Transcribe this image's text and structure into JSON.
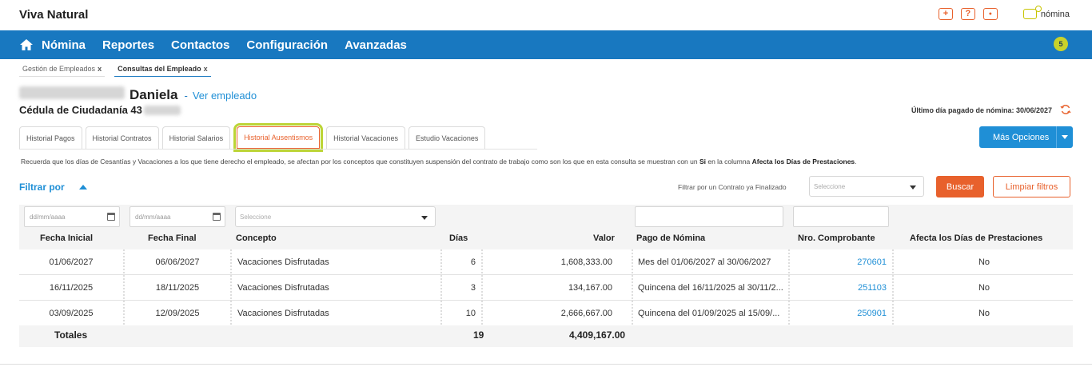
{
  "app": {
    "title": "Viva Natural"
  },
  "top_icons": [
    {
      "name": "plus-icon",
      "glyph": "+"
    },
    {
      "name": "help-icon",
      "glyph": "?"
    },
    {
      "name": "user-icon",
      "glyph": "●"
    }
  ],
  "chat": {
    "label": "nómina",
    "icon": "chat-icon"
  },
  "nav": {
    "items": [
      "Nómina",
      "Reportes",
      "Contactos",
      "Configuración",
      "Avanzadas"
    ],
    "badge": "5"
  },
  "breadcrumbs": [
    {
      "label": "Gestión de Empleados",
      "close": "x"
    },
    {
      "label": "Consultas del Empleado",
      "close": "x"
    }
  ],
  "employee": {
    "first_name": "Daniela",
    "separator": "-",
    "view_link": "Ver empleado",
    "id_label": "Cédula de Ciudadanía 43"
  },
  "last_paid": "Último día pagado de nómina: 30/06/2027",
  "tabs": [
    "Historial Pagos",
    "Historial Contratos",
    "Historial Salarios",
    "Historial Ausentismos",
    "Historial Vacaciones",
    "Estudio Vacaciones"
  ],
  "active_tab": "Historial Ausentismos",
  "more_options": "Más Opciones",
  "notice": {
    "pre": "Recuerda que los días de Cesantías y Vacaciones a los que tiene derecho el empleado, se afectan por los conceptos que constituyen suspensión del contrato de trabajo como son los que en esta consulta se muestran con un ",
    "si": "Si",
    "mid": " en la columna ",
    "col": "Afecta los Días de Prestaciones",
    "end": "."
  },
  "filters": {
    "title": "Filtrar por",
    "contrato_label": "Filtrar por un Contrato ya Finalizado",
    "contrato_placeholder": "Seleccione",
    "date_placeholder": "dd/mm/aaaa",
    "concepto_placeholder": "Seleccione",
    "buscar": "Buscar",
    "limpiar": "Limpiar filtros"
  },
  "table": {
    "headers": [
      "Fecha Inicial",
      "Fecha Final",
      "Concepto",
      "Días",
      "Valor",
      "Pago de Nómina",
      "Nro. Comprobante",
      "Afecta los Días de Prestaciones"
    ],
    "rows": [
      {
        "inicio": "01/06/2027",
        "fin": "06/06/2027",
        "concepto": "Vacaciones Disfrutadas",
        "dias": "6",
        "valor": "1,608,333.00",
        "pago": "Mes del 01/06/2027 al 30/06/2027",
        "comprobante": "270601",
        "afecta": "No"
      },
      {
        "inicio": "16/11/2025",
        "fin": "18/11/2025",
        "concepto": "Vacaciones Disfrutadas",
        "dias": "3",
        "valor": "134,167.00",
        "pago": "Quincena del 16/11/2025 al 30/11/2...",
        "comprobante": "251103",
        "afecta": "No"
      },
      {
        "inicio": "03/09/2025",
        "fin": "12/09/2025",
        "concepto": "Vacaciones Disfrutadas",
        "dias": "10",
        "valor": "2,666,667.00",
        "pago": "Quincena del 01/09/2025 al 15/09/...",
        "comprobante": "250901",
        "afecta": "No"
      }
    ],
    "totals": {
      "label": "Totales",
      "dias": "19",
      "valor": "4,409,167.00"
    }
  },
  "colors": {
    "primary": "#1878c0",
    "accent": "#e8612c",
    "highlight": "#bcd436",
    "badge": "#c9d22b",
    "link": "#1f8fd6"
  }
}
